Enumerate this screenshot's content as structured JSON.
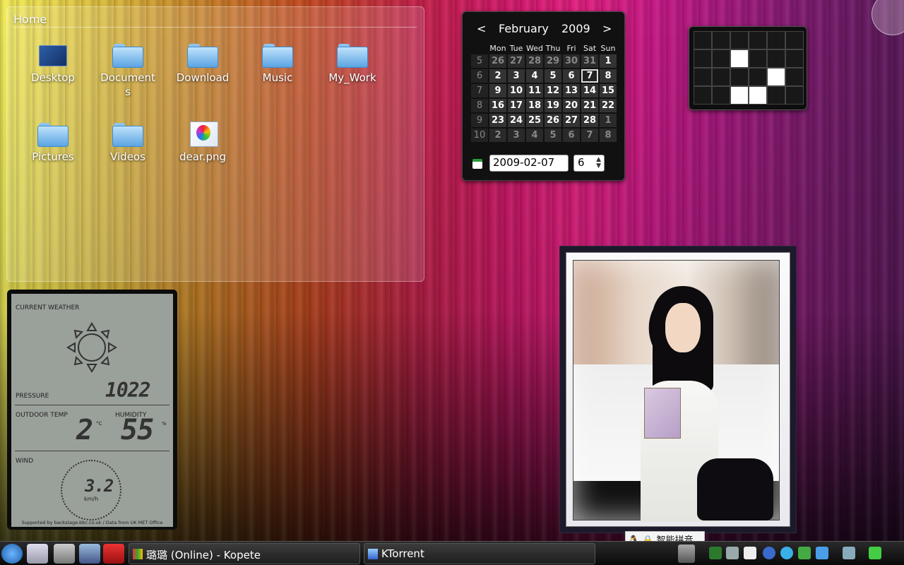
{
  "folderview": {
    "title": "Home",
    "items": [
      {
        "label": "Desktop",
        "icon": "desktop-icon"
      },
      {
        "label": "Documents",
        "icon": "folder-icon"
      },
      {
        "label": "Download",
        "icon": "folder-icon"
      },
      {
        "label": "Music",
        "icon": "folder-icon"
      },
      {
        "label": "My_Work",
        "icon": "folder-icon"
      },
      {
        "label": "Pictures",
        "icon": "folder-icon"
      },
      {
        "label": "Videos",
        "icon": "folder-icon"
      },
      {
        "label": "dear.png",
        "icon": "image-file-icon"
      }
    ]
  },
  "calendar": {
    "prev": "<",
    "month": "February",
    "year": "2009",
    "next": ">",
    "days": [
      "Mon",
      "Tue",
      "Wed",
      "Thu",
      "Fri",
      "Sat",
      "Sun"
    ],
    "weeks": [
      {
        "num": "5",
        "days": [
          "26",
          "27",
          "28",
          "29",
          "30",
          "31",
          "1"
        ]
      },
      {
        "num": "6",
        "days": [
          "2",
          "3",
          "4",
          "5",
          "6",
          "7",
          "8"
        ]
      },
      {
        "num": "7",
        "days": [
          "9",
          "10",
          "11",
          "12",
          "13",
          "14",
          "15"
        ]
      },
      {
        "num": "8",
        "days": [
          "16",
          "17",
          "18",
          "19",
          "20",
          "21",
          "22"
        ]
      },
      {
        "num": "9",
        "days": [
          "23",
          "24",
          "25",
          "26",
          "27",
          "28",
          "1"
        ]
      },
      {
        "num": "10",
        "days": [
          "2",
          "3",
          "4",
          "5",
          "6",
          "7",
          "8"
        ]
      }
    ],
    "selected_date": "2009-02-07",
    "week_number": "6"
  },
  "puzzle": {
    "cells": [
      0,
      0,
      0,
      0,
      0,
      0,
      0,
      0,
      1,
      0,
      0,
      0,
      0,
      0,
      0,
      0,
      1,
      0,
      0,
      0,
      1,
      1,
      0,
      0
    ]
  },
  "weather": {
    "current_label": "CURRENT WEATHER",
    "pressure_label": "PRESSURE",
    "pressure": "1022",
    "outdoor_label": "OUTDOOR TEMP",
    "temp": "2",
    "temp_unit": "°C",
    "humidity_label": "HUMIDITY",
    "humidity": "55",
    "humidity_unit": "%",
    "wind_label": "WIND",
    "wind": "3.2",
    "wind_unit": "km/h",
    "footer": "Supported by backstage.bbc.co.uk / Data from UK MET Office"
  },
  "ime": {
    "label": "智能拼音"
  },
  "taskbar": {
    "tasks": [
      {
        "label": "璐璐 (Online) - Kopete",
        "icon": "kopete-icon"
      },
      {
        "label": "KTorrent",
        "icon": "ktorrent-icon"
      }
    ]
  },
  "colors": {
    "accent": "#5ba4e3",
    "calendar_bg": "#111111",
    "lcd": "#9aa09a"
  }
}
